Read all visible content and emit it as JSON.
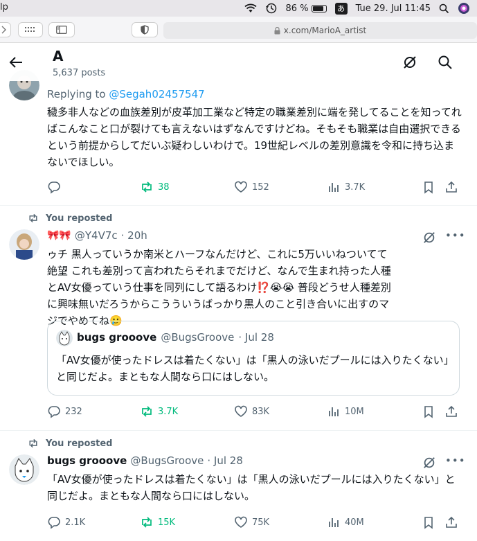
{
  "menubar": {
    "app_fragment": "lp",
    "battery_percent": "86 %",
    "battery_level": 0.86,
    "input_char": "あ",
    "datetime": "Tue 29. Jul  11:45"
  },
  "browser": {
    "url": "x.com/MarioA_artist"
  },
  "header": {
    "title": "A",
    "posts_count": "5,637 posts"
  },
  "posts": [
    {
      "replying_prefix": "Replying to ",
      "replying_handle": "@Segah02457547",
      "text": "穢多非人などの血族差別が皮革加工業など特定の職業差別に端を発してることを知ってればこんなこと口が裂けても言えないはずなんですけどね。そもそも職業は自由選択できるという前提からしてだいぶ疑わしいわけで。19世紀レベルの差別意識を令和に持ち込まないでほしい。",
      "replies": "",
      "reposts": "38",
      "likes": "152",
      "views": "3.7K"
    },
    {
      "repost_label": "You reposted",
      "name_emoji": "🎀🎀",
      "handle": "@Y4V7c",
      "time": "· 20h",
      "text": "ゥチ 黒人っていうか南米とハーフなんだけど、これに5万いいねついてて絶望 これも差別って言われたらそれまでだけど、なんで生まれ持った人種とAV女優っていう仕事を同列にして語るわけ⁉️😭😭 普段どうせ人種差別に興味無いだろうからこうういうばっかり黒人のこと引き合いに出すのマジでやめてね🥲",
      "quote": {
        "name": "bugs grooove",
        "handle": "@BugsGroove",
        "date": "· Jul 28",
        "text": "「AV女優が使ったドレスは着たくない」は「黒人の泳いだプールには入りたくない」と同じだよ。まともな人間なら口にはしない。"
      },
      "replies": "232",
      "reposts": "3.7K",
      "likes": "83K",
      "views": "10M"
    },
    {
      "repost_label": "You reposted",
      "name": "bugs grooove",
      "handle": "@BugsGroove",
      "time": "· Jul 28",
      "text": "「AV女優が使ったドレスは着たくない」は「黒人の泳いだプールには入りたくない」と同じだよ。まともな人間なら口にはしない。",
      "replies": "2.1K",
      "reposts": "15K",
      "likes": "75K",
      "views": "40M"
    }
  ],
  "colors": {
    "accent": "#1d9bf0",
    "repost_green": "#00ba7c",
    "secondary_text": "#536471"
  }
}
